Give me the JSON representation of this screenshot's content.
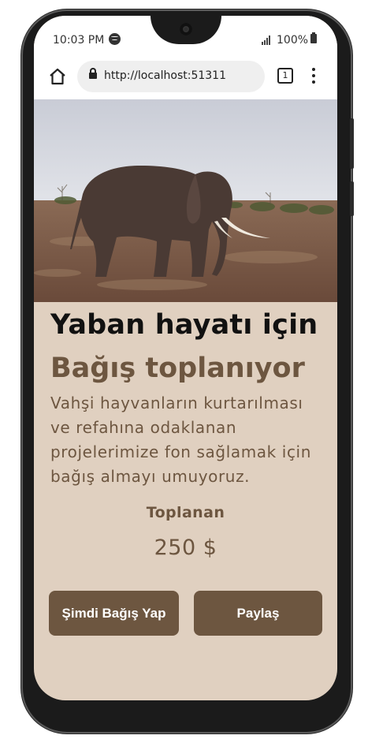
{
  "status_bar": {
    "time": "10:03 PM",
    "battery": "100%"
  },
  "browser": {
    "url": "http://localhost:51311",
    "tab_count": "1"
  },
  "page": {
    "hero_image": "elephant-photo",
    "title_line1": "Yaban hayatı için",
    "title_line2": "Bağış toplanıyor",
    "description": "Vahşi hayvanların kurtarılması ve refahına odaklanan projelerimize fon sağlamak için bağış almayı umuyoruz.",
    "collected_label": "Toplanan",
    "collected_amount": "250 $",
    "donate_button": "Şimdi Bağış Yap",
    "share_button": "Paylaş"
  },
  "colors": {
    "background": "#e0d0c0",
    "accent": "#6d5640"
  }
}
